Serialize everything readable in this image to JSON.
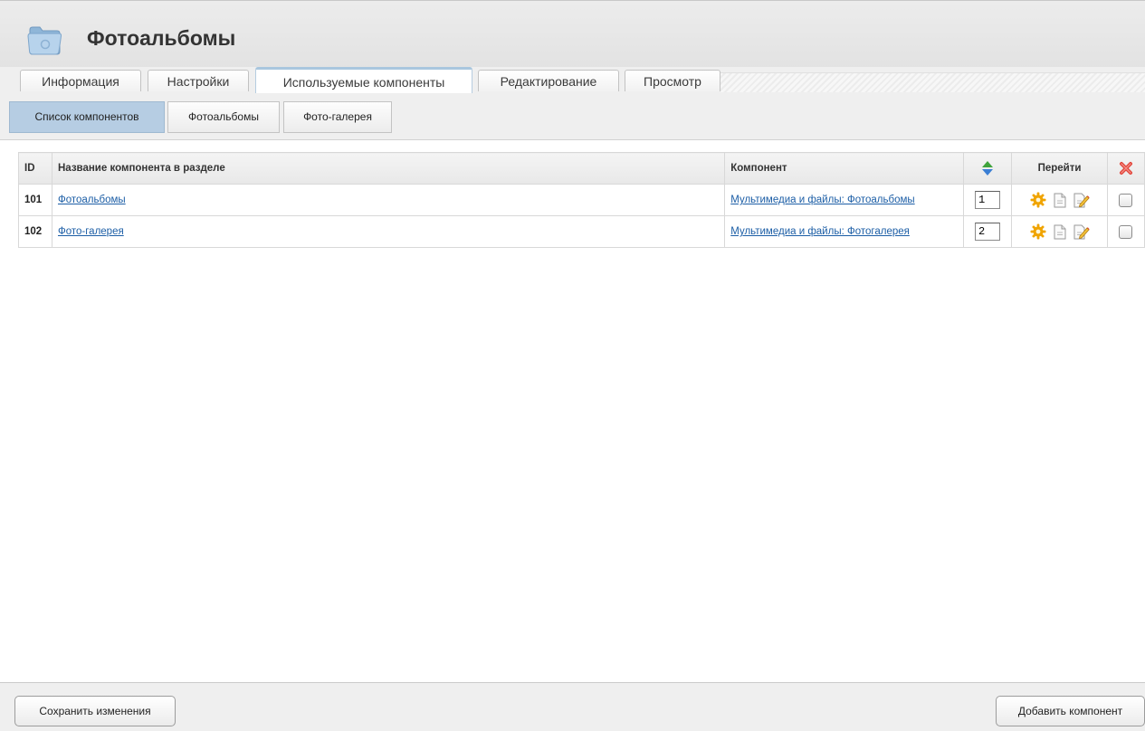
{
  "header": {
    "title": "Фотоальбомы",
    "icon": "folder-icon"
  },
  "tabs": [
    {
      "label": "Информация",
      "active": false
    },
    {
      "label": "Настройки",
      "active": false
    },
    {
      "label": "Используемые компоненты",
      "active": true
    },
    {
      "label": "Редактирование",
      "active": false
    },
    {
      "label": "Просмотр",
      "active": false
    }
  ],
  "subtabs": [
    {
      "label": "Список компонентов",
      "active": true
    },
    {
      "label": "Фотоальбомы",
      "active": false
    },
    {
      "label": "Фото-галерея",
      "active": false
    }
  ],
  "table": {
    "columns": {
      "id": "ID",
      "name": "Название компонента в разделе",
      "component": "Компонент",
      "order_icon": "sort-arrows-icon",
      "goto": "Перейти",
      "delete_icon": "delete-x-icon"
    },
    "rows": [
      {
        "id": "101",
        "name": "Фотоальбомы",
        "component": "Мультимедиа и файлы: Фотоальбомы",
        "order": "1"
      },
      {
        "id": "102",
        "name": "Фото-галерея",
        "component": "Мультимедиа и файлы: Фотогалерея",
        "order": "2"
      }
    ]
  },
  "footer": {
    "save_label": "Сохранить изменения",
    "add_label": "Добавить компонент"
  },
  "colors": {
    "link": "#1c5ea6",
    "active_subtab": "#b6cde3",
    "sort_up": "#3fa33b",
    "sort_down": "#3b7fd4",
    "delete": "#e0443a",
    "gear": "#f0a400"
  }
}
